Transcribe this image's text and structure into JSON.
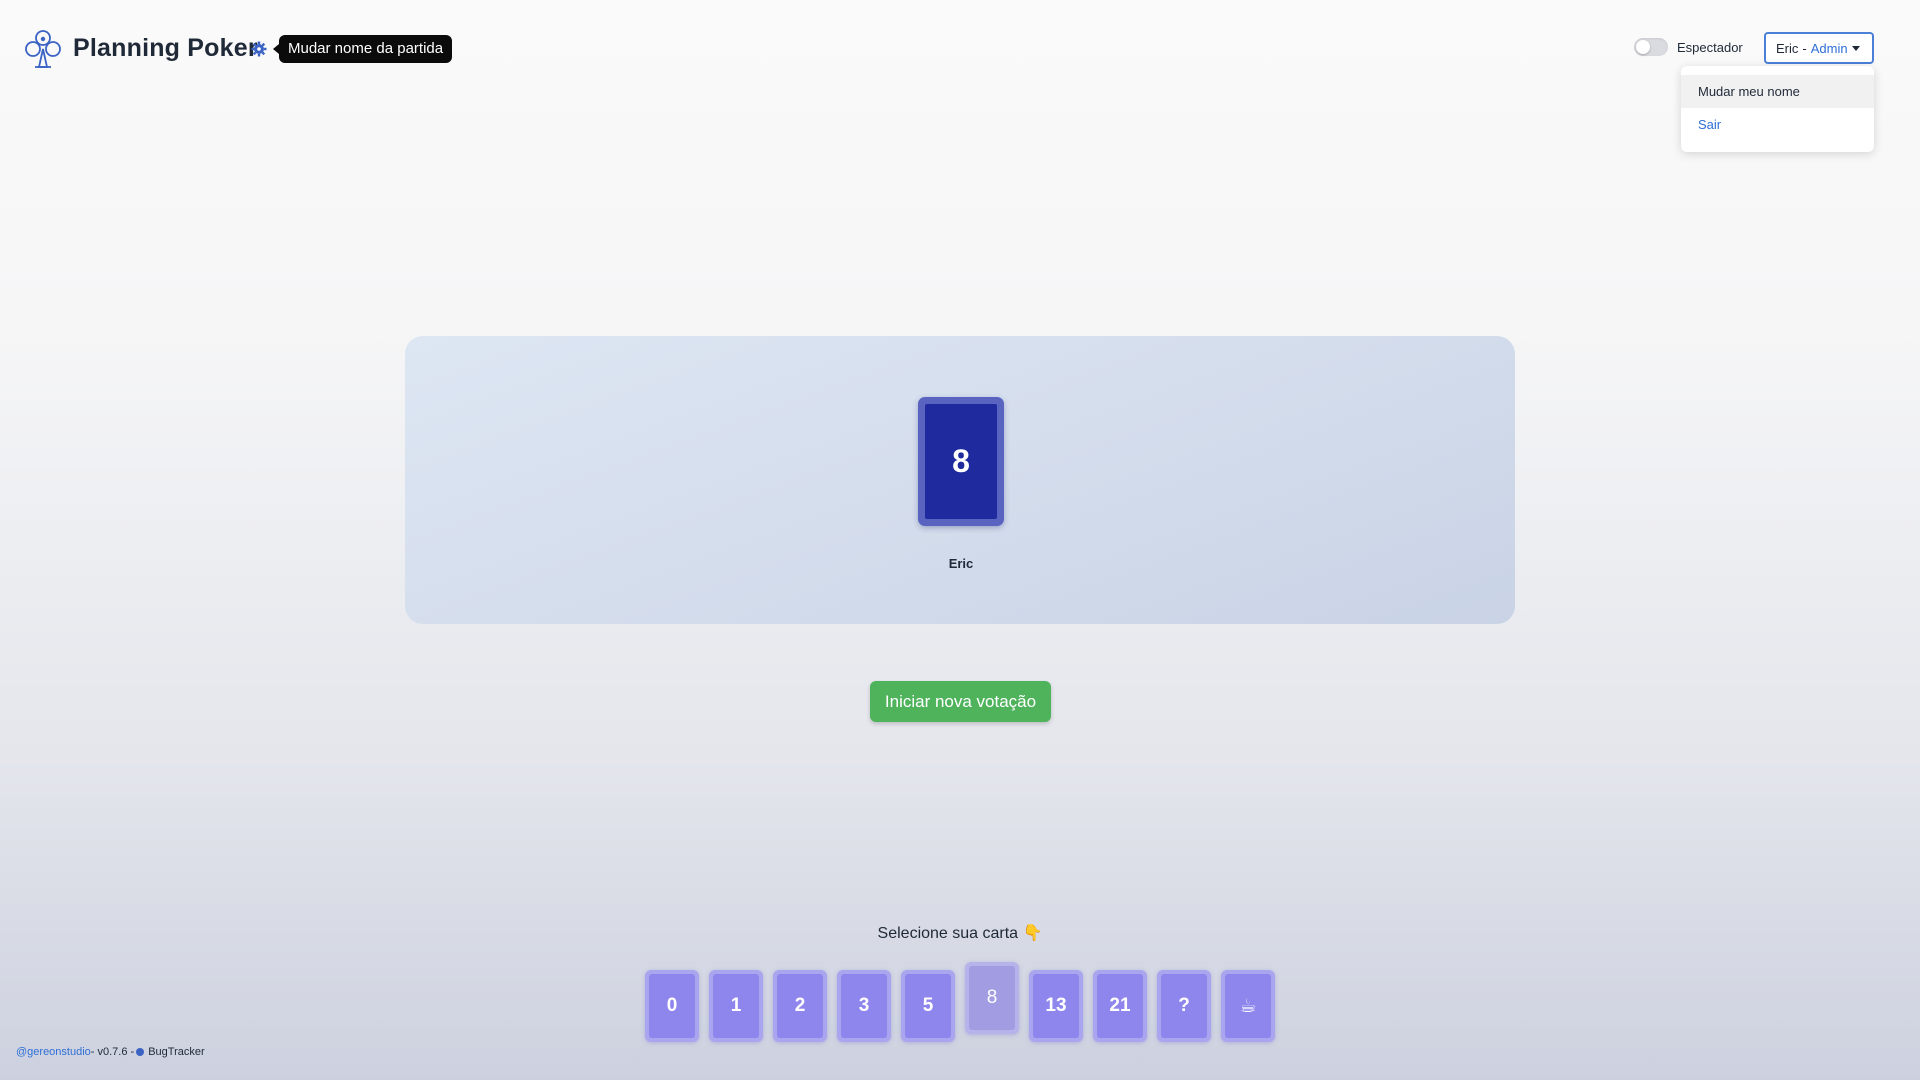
{
  "header": {
    "title": "Planning Poker",
    "tooltip": "Mudar nome da partida",
    "spectator_label": "Espectador",
    "spectator_on": false,
    "user_name": "Eric",
    "user_separator": "-",
    "user_role": "Admin"
  },
  "dropdown": {
    "items": [
      {
        "label": "Mudar meu nome"
      },
      {
        "label": "Sair"
      }
    ]
  },
  "table": {
    "played_value": "8",
    "player_name": "Eric"
  },
  "actions": {
    "new_vote": "Iniciar nova votação"
  },
  "deck": {
    "prompt": "Selecione sua carta",
    "prompt_emoji": "👇",
    "cards": [
      "0",
      "1",
      "2",
      "3",
      "5",
      "8",
      "13",
      "21",
      "?",
      "☕"
    ],
    "selected": "8"
  },
  "footer": {
    "studio": "@gereonstudio",
    "version": " - v0.7.6 - ",
    "bugtracker": "BugTracker"
  },
  "colors": {
    "accent": "#2f6fd6",
    "played_card": "#1e2a9d",
    "deck_card": "#8e86ec",
    "new_vote_button": "#4fb35c"
  }
}
